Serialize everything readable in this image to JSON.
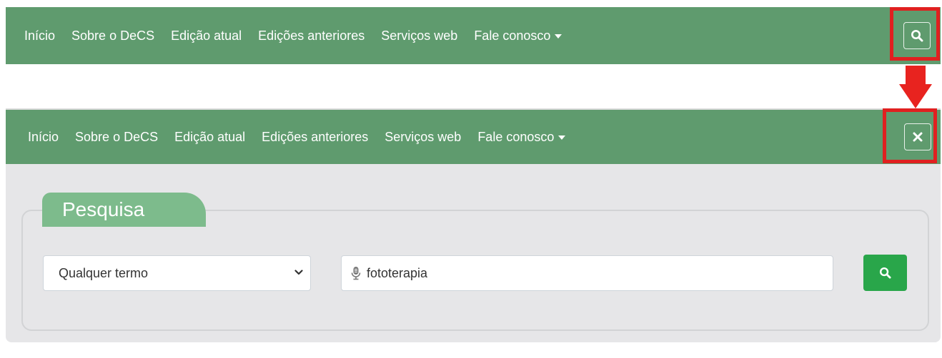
{
  "nav": {
    "items": [
      "Início",
      "Sobre o DeCS",
      "Edição atual",
      "Edições anteriores",
      "Serviços web"
    ],
    "dropdown_label": "Fale conosco"
  },
  "icons": {
    "search_toggle": "search-icon",
    "close_toggle": "close-icon",
    "arrow": "down-arrow",
    "microphone": "microphone-icon",
    "dropdown": "chevron-down-icon"
  },
  "search": {
    "legend": "Pesquisa",
    "scope_selected": "Qualquer termo",
    "query": "fototerapia"
  },
  "colors": {
    "navbar": "#5f9b6e",
    "legend_tab": "#7dbb8c",
    "panel": "#e6e6e8",
    "search_button": "#29a64a",
    "highlight": "#e02020"
  }
}
